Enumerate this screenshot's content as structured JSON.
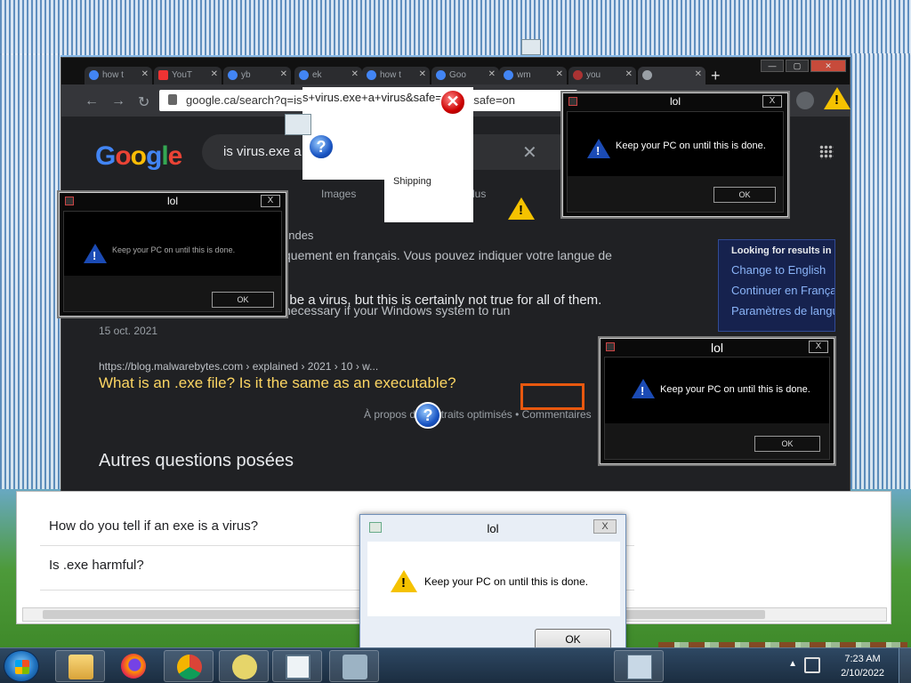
{
  "browser": {
    "tabs": [
      {
        "label": "how t",
        "icon": "google-icon"
      },
      {
        "label": "YouT",
        "icon": "youtube-icon"
      },
      {
        "label": "yb",
        "icon": "google-icon"
      },
      {
        "label": "ek",
        "icon": "google-icon"
      },
      {
        "label": "how t",
        "icon": "google-icon"
      },
      {
        "label": "Goo",
        "icon": "google-icon"
      },
      {
        "label": "wm",
        "icon": "google-icon"
      },
      {
        "label": "you",
        "icon": "virus-icon"
      },
      {
        "label": "",
        "icon": "globe-icon",
        "active": true
      }
    ],
    "url": "google.ca/search?q=is+virus.exe+a+virus&safe=active&safe=on",
    "search_query": "is virus.exe a virus",
    "tab_images": "Images",
    "tab_plus": "Plus"
  },
  "results": {
    "frag1": "ondes",
    "frag2": "quement en français. Vous pouvez indiquer votre langue de",
    "frag3": "can be a virus, but this is certainly not true for all of them.",
    "frag4": "necessary if your Windows system to run",
    "date": "15 oct. 2021",
    "url": "https://blog.malwarebytes.com › explained › 2021 › 10 › w...",
    "title": "What is an .exe file? Is it the same as an executable?",
    "footer": "À propos des extraits optimisés  •  Commentaires",
    "paa_heading": "Autres questions posées"
  },
  "lang_box": {
    "title": "Looking for results in",
    "change": "Change to English",
    "continue": "Continuer en Français",
    "params": "Paramètres de langue"
  },
  "paa_items": [
    "How do you tell if an exe is a virus?",
    "Is .exe harmful?"
  ],
  "glitch": {
    "text": "s+virus.exe+a+virus&safe=a",
    "shipping": "Shipping"
  },
  "dialogs": {
    "title": "lol",
    "message": "Keep your PC on until this is done.",
    "msg_fragment": "Keep your PC on until this is done.",
    "ok": "OK",
    "close": "X"
  },
  "taskbar": {
    "time": "7:23 AM",
    "date": "2/10/2022"
  },
  "colors": {
    "dialog_warn_blue": "#1b4bb5",
    "highlight_orange": "#e8580f",
    "accent_blue": "#8ab4f8"
  }
}
